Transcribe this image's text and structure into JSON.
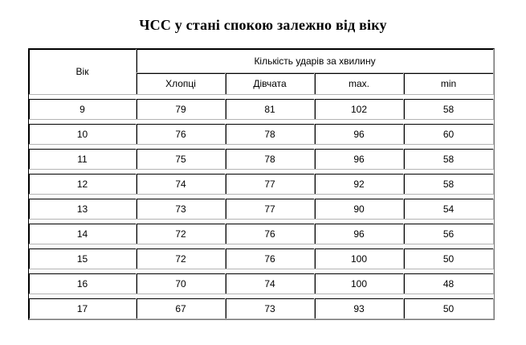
{
  "title": "ЧСС у стані спокою залежно від віку",
  "table": {
    "age_header": "Вік",
    "group_header": "Кількість ударів за хвилину",
    "sub_headers": [
      "Хлопці",
      "Дівчата",
      "max.",
      "min"
    ],
    "rows": [
      [
        "9",
        "79",
        "81",
        "102",
        "58"
      ],
      [
        "10",
        "76",
        "78",
        "96",
        "60"
      ],
      [
        "11",
        "75",
        "78",
        "96",
        "58"
      ],
      [
        "12",
        "74",
        "77",
        "92",
        "58"
      ],
      [
        "13",
        "73",
        "77",
        "90",
        "54"
      ],
      [
        "14",
        "72",
        "76",
        "96",
        "56"
      ],
      [
        "15",
        "72",
        "76",
        "100",
        "50"
      ],
      [
        "16",
        "70",
        "74",
        "100",
        "48"
      ],
      [
        "17",
        "67",
        "73",
        "93",
        "50"
      ]
    ]
  }
}
